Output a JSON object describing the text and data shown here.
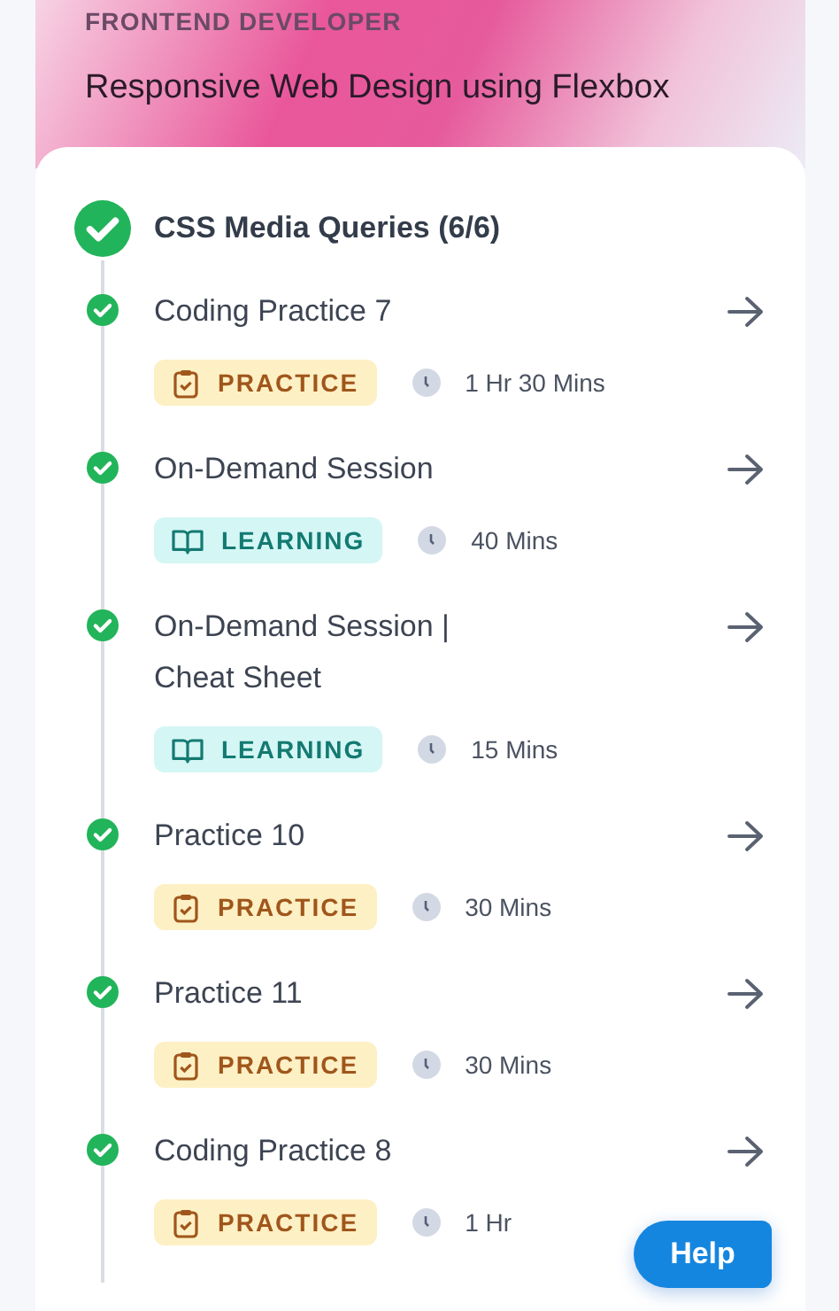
{
  "header": {
    "track": "FRONTEND DEVELOPER",
    "title": "Responsive Web Design using Flexbox"
  },
  "section": {
    "title": "CSS Media Queries (6/6)",
    "completed": true
  },
  "items": [
    {
      "title": "Coding Practice 7",
      "completed": true,
      "kind": "practice",
      "tag": "PRACTICE",
      "duration": "1 Hr 30 Mins"
    },
    {
      "title": "On-Demand Session",
      "completed": true,
      "kind": "learning",
      "tag": "LEARNING",
      "duration": "40 Mins"
    },
    {
      "title": "On-Demand Session | Cheat Sheet",
      "completed": true,
      "kind": "learning",
      "tag": "LEARNING",
      "duration": "15 Mins"
    },
    {
      "title": "Practice 10",
      "completed": true,
      "kind": "practice",
      "tag": "PRACTICE",
      "duration": "30 Mins"
    },
    {
      "title": "Practice 11",
      "completed": true,
      "kind": "practice",
      "tag": "PRACTICE",
      "duration": "30 Mins"
    },
    {
      "title": "Coding Practice 8",
      "completed": true,
      "kind": "practice",
      "tag": "PRACTICE",
      "duration": "1 Hr"
    }
  ],
  "help_button": {
    "label": "Help"
  }
}
